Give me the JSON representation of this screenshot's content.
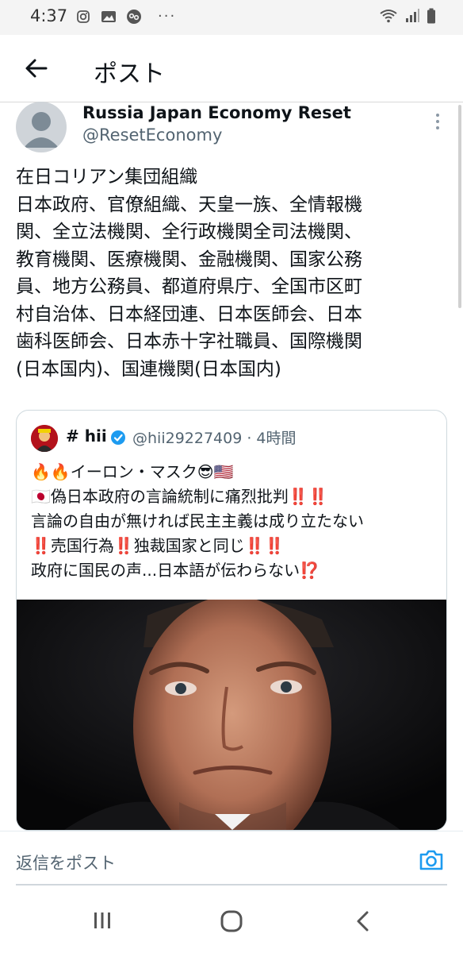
{
  "status_bar": {
    "time": "4:37",
    "left_icons": [
      "instagram-icon",
      "gallery-icon",
      "link-icon"
    ],
    "more": "···",
    "right_icons": [
      "wifi-icon",
      "signal-icon",
      "battery-icon"
    ]
  },
  "app_bar": {
    "title": "ポスト"
  },
  "post": {
    "author_name": "Russia Japan Economy Reset",
    "author_handle": "@ResetEconomy",
    "text_lines": [
      "在日コリアン集団組織",
      "日本政府、官僚組織、天皇一族、全情報機",
      "関、全立法機関、全行政機関全司法機関、",
      "教育機関、医療機関、金融機関、国家公務",
      "員、地方公務員、都道府県庁、全国市区町",
      "村自治体、日本経団連、日本医師会、日本",
      "歯科医師会、日本赤十字社職員、国際機関",
      "(日本国内)、国連機関(日本国内)"
    ]
  },
  "quote": {
    "name": "# hii",
    "handle_time": "@hii29227409 · 4時間",
    "text_lines": [
      "🔥🔥イーロン・マスク😎🇺🇸",
      "🇯🇵偽日本政府の言論統制に痛烈批判‼️‼️",
      "言論の自由が無ければ民主主義は成り立たない",
      "‼️売国行為‼️独裁国家と同じ‼️‼️",
      "政府に国民の声...日本語が伝わらない⁉️"
    ],
    "image_alt": "photo-portrait"
  },
  "reply": {
    "placeholder": "返信をポスト"
  },
  "colors": {
    "text_primary": "#0f1419",
    "text_secondary": "#536471",
    "accent": "#1d9bf0",
    "border": "#cfd9de"
  }
}
